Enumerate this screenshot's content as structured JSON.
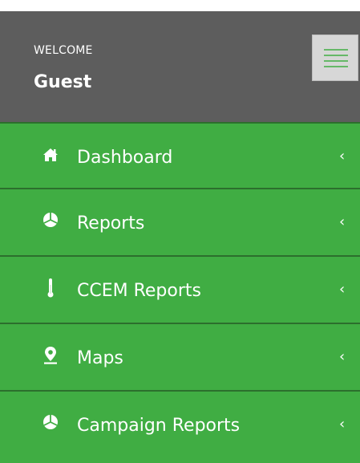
{
  "header": {
    "welcome_label": "WELCOME",
    "user_name": "Guest"
  },
  "nav": {
    "items": [
      {
        "label": "Dashboard",
        "icon": "home-icon"
      },
      {
        "label": "Reports",
        "icon": "pie-chart-icon"
      },
      {
        "label": "CCEM Reports",
        "icon": "thermometer-icon"
      },
      {
        "label": "Maps",
        "icon": "map-marker-icon"
      },
      {
        "label": "Campaign Reports",
        "icon": "pie-chart-icon"
      }
    ],
    "chevron": "‹"
  },
  "colors": {
    "header_bg": "#5d5d5d",
    "nav_bg": "#40ad43",
    "divider": "#2c6f2d",
    "toggle_bg": "#d7d7d7",
    "toggle_lines": "#40ad43",
    "text": "#ffffff"
  }
}
